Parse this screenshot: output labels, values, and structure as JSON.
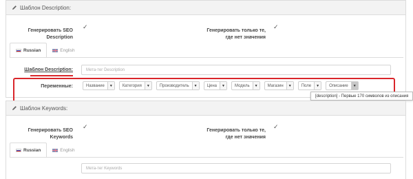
{
  "description_panel": {
    "title": "Шаблон Description:",
    "gen_seo_label_1": "Генерировать SEO",
    "gen_seo_label_2": "Description",
    "gen_empty_label_1": "Генерировать только те,",
    "gen_empty_label_2": "где нет значения",
    "gen_seo_checked": "✓",
    "gen_empty_checked": "✓",
    "tabs": [
      {
        "label": "Russian"
      },
      {
        "label": "English"
      }
    ],
    "template_label": "Шаблон Description:",
    "template_placeholder": "Мета-тег Description",
    "variables_label": "Переменные:",
    "variables": [
      {
        "label": "Название"
      },
      {
        "label": "Категория"
      },
      {
        "label": "Производитель"
      },
      {
        "label": "Цена"
      },
      {
        "label": "Модель"
      },
      {
        "label": "Магазин"
      },
      {
        "label": "Поле"
      },
      {
        "label": "Описание"
      }
    ],
    "tooltip": "[description] - Первые 170 символов из описания"
  },
  "keywords_panel": {
    "title": "Шаблон Keywords:",
    "gen_seo_label_1": "Генерировать SEO",
    "gen_seo_label_2": "Keywords",
    "gen_empty_label_1": "Генерировать только те,",
    "gen_empty_label_2": "где нет значения",
    "gen_seo_checked": "✓",
    "gen_empty_checked": "✓",
    "tabs": [
      {
        "label": "Russian"
      },
      {
        "label": "English"
      }
    ],
    "template_placeholder": "Мета-тег Keywords"
  },
  "colors": {
    "highlight": "#d9252a",
    "panel_header_bg": "#f3f3f3",
    "border": "#dcdcdc"
  }
}
